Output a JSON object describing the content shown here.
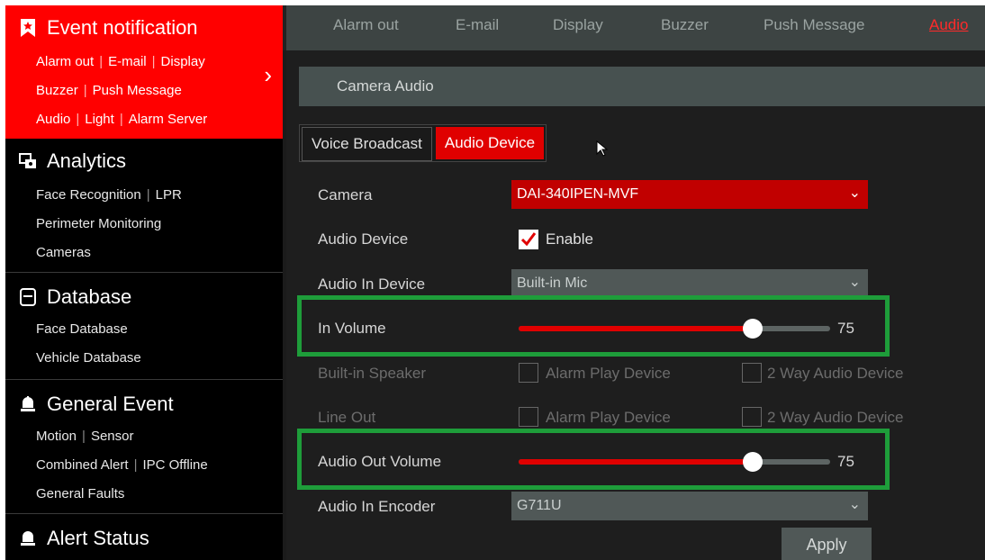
{
  "sidebar": {
    "event_notification": {
      "title": "Event notification",
      "row1": [
        "Alarm out",
        "E-mail",
        "Display"
      ],
      "row2": [
        "Buzzer",
        "Push Message"
      ],
      "row3": [
        "Audio",
        "Light",
        "Alarm Server"
      ]
    },
    "analytics": {
      "title": "Analytics",
      "row1": [
        "Face Recognition",
        "LPR"
      ],
      "row2": "Perimeter Monitoring",
      "row3": "Cameras"
    },
    "database": {
      "title": "Database",
      "row1": "Face Database",
      "row2": "Vehicle Database"
    },
    "general_event": {
      "title": "General Event",
      "row1": [
        "Motion",
        "Sensor"
      ],
      "row2": [
        "Combined Alert",
        "IPC Offline"
      ],
      "row3": "General Faults"
    },
    "alert_status": {
      "title": "Alert Status"
    }
  },
  "top_tabs": [
    "Alarm out",
    "E-mail",
    "Display",
    "Buzzer",
    "Push Message",
    "Audio"
  ],
  "section_title": "Camera Audio",
  "sub_tabs": [
    "Voice Broadcast",
    "Audio Device"
  ],
  "form": {
    "camera_label": "Camera",
    "camera_value": "DAI-340IPEN-MVF",
    "audio_device_label": "Audio Device",
    "enable_label": "Enable",
    "audio_in_device_label": "Audio In Device",
    "audio_in_device_value": "Built-in Mic",
    "in_volume_label": "In Volume",
    "in_volume_value": "75",
    "builtin_speaker_label": "Built-in Speaker",
    "line_out_label": "Line Out",
    "alarm_play_device": "Alarm Play Device",
    "two_way_audio_device": "2 Way Audio Device",
    "audio_out_volume_label": "Audio Out Volume",
    "audio_out_volume_value": "75",
    "audio_in_encoder_label": "Audio In Encoder",
    "audio_in_encoder_value": "G711U",
    "apply_label": "Apply"
  },
  "colors": {
    "accent": "#e00000",
    "highlight": "#1e9d3a"
  }
}
